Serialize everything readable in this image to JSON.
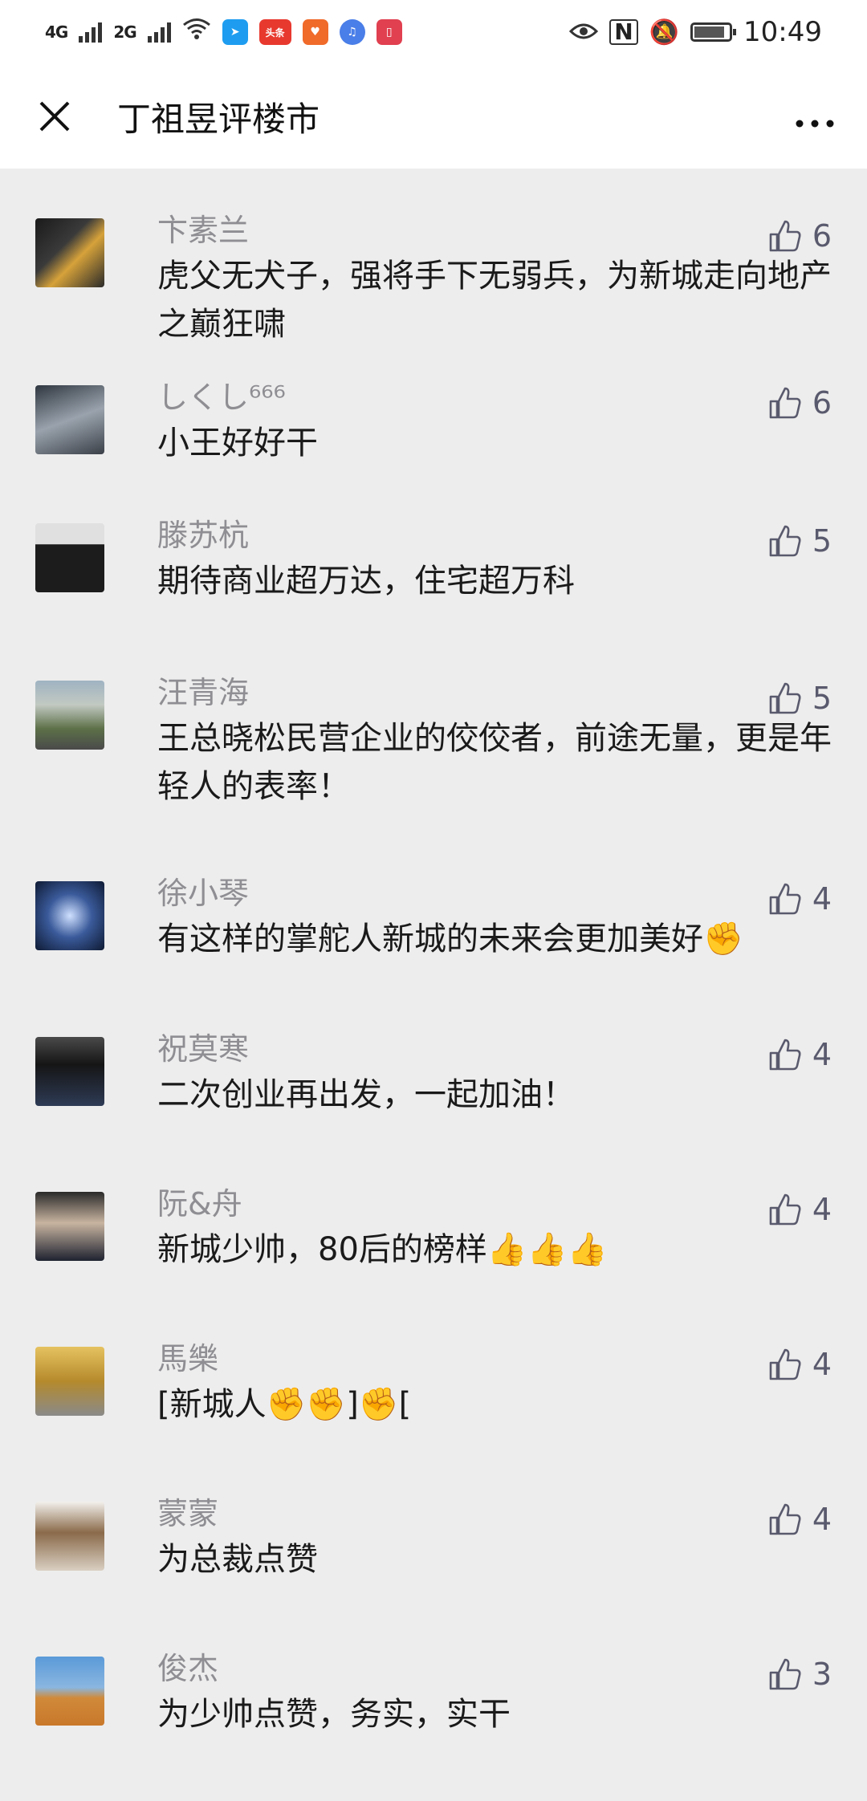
{
  "status_bar": {
    "net1": "4G",
    "net2": "2G",
    "app_toutiao": "头条",
    "time": "10:49"
  },
  "header": {
    "title": "丁祖昱评楼市",
    "close_icon": "close-icon",
    "more_icon": "more-icon"
  },
  "comments": [
    {
      "name": "卞素兰",
      "text": "虎父无犬子，强将手下无弱兵，为新城走向地产之巅狂啸",
      "likes": "6",
      "avatar_color": "#3a3a3a"
    },
    {
      "name": "しくし⁶⁶⁶",
      "text": "小王好好干",
      "likes": "6",
      "avatar_color": "#6b7280"
    },
    {
      "name": "滕苏杭",
      "text": "期待商业超万达，住宅超万科",
      "likes": "5",
      "avatar_color": "#cfcfcf"
    },
    {
      "name": "汪青海",
      "text": "王总晓松民营企业的佼佼者，前途无量，更是年轻人的表率！",
      "likes": "5",
      "avatar_color": "#6d7b5a"
    },
    {
      "name": "徐小琴",
      "text": "有这样的掌舵人新城的未来会更加美好✊",
      "likes": "4",
      "avatar_color": "#2c3e64"
    },
    {
      "name": "祝莫寒",
      "text": "二次创业再出发，一起加油！",
      "likes": "4",
      "avatar_color": "#202020"
    },
    {
      "name": "阮&舟",
      "text": "新城少帅，80后的榜样👍👍👍",
      "likes": "4",
      "avatar_color": "#2a2a2a"
    },
    {
      "name": "馬樂",
      "text": "[新城人✊✊]✊[",
      "likes": "4",
      "avatar_color": "#c9a44a"
    },
    {
      "name": "蒙蒙",
      "text": "为总裁点赞",
      "likes": "4",
      "avatar_color": "#d9d2c8"
    },
    {
      "name": "俊杰",
      "text": "为少帅点赞，务实，实干",
      "likes": "3",
      "avatar_color": "#c98a3c"
    }
  ],
  "colors": {
    "background": "#ededed",
    "name_gray": "#8e8e93",
    "like_gray": "#5a5a6e"
  }
}
